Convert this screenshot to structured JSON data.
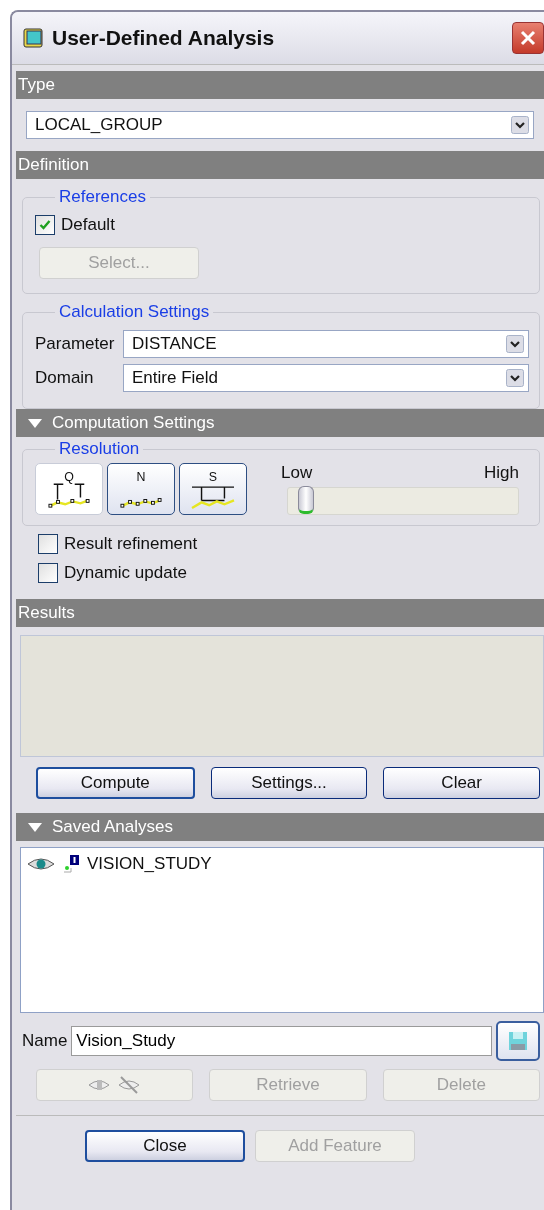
{
  "window": {
    "title": "User-Defined Analysis"
  },
  "type_section": {
    "header": "Type",
    "dropdown_value": "LOCAL_GROUP"
  },
  "definition_section": {
    "header": "Definition",
    "references": {
      "title": "References",
      "checkbox": {
        "label": "Default",
        "checked": true
      },
      "select_button": {
        "label": "Select...",
        "disabled": true
      }
    },
    "calculation": {
      "title": "Calculation Settings",
      "fields": [
        {
          "label": "Parameter",
          "value": "DISTANCE"
        },
        {
          "label": "Domain",
          "value": "Entire Field"
        }
      ]
    }
  },
  "computation_section": {
    "header": "Computation Settings",
    "expanded": true,
    "resolution": {
      "title": "Resolution",
      "modes": [
        {
          "kind": "quality",
          "letter": "Q",
          "selected": true
        },
        {
          "kind": "number",
          "letter": "N",
          "selected": false
        },
        {
          "kind": "step",
          "letter": "S",
          "selected": false
        }
      ],
      "slider": {
        "min_label": "Low",
        "max_label": "High",
        "level": 0.05
      }
    },
    "options": [
      {
        "label": "Result refinement",
        "checked": false
      },
      {
        "label": "Dynamic update",
        "checked": false
      }
    ]
  },
  "results_section": {
    "header": "Results",
    "buttons": [
      {
        "label": "Compute",
        "disabled": false,
        "default": true
      },
      {
        "label": "Settings...",
        "disabled": false,
        "default": false
      },
      {
        "label": "Clear",
        "disabled": false,
        "default": false
      }
    ]
  },
  "saved_section": {
    "header": "Saved Analyses",
    "expanded": true,
    "items": [
      {
        "name": "VISION_STUDY",
        "visible": true
      }
    ],
    "name_field": {
      "label": "Name",
      "value": "Vision_Study"
    },
    "actions": [
      {
        "kind": "visibility",
        "disabled": true
      },
      {
        "kind": "text",
        "label": "Retrieve",
        "disabled": true
      },
      {
        "kind": "text",
        "label": "Delete",
        "disabled": true
      }
    ]
  },
  "footer_buttons": [
    {
      "label": "Close",
      "disabled": false
    },
    {
      "label": "Add Feature",
      "disabled": true
    }
  ]
}
